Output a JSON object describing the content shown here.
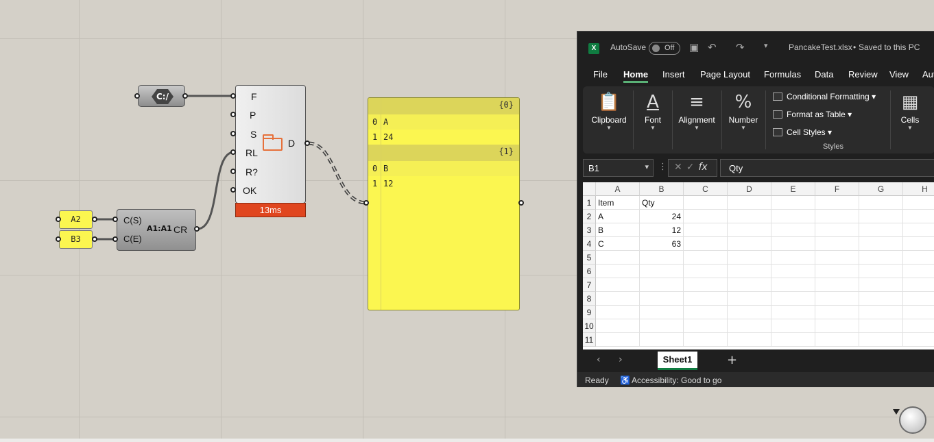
{
  "grasshopper": {
    "path_component": {
      "glyph": "C:/"
    },
    "panels_small": [
      {
        "text": "A2"
      },
      {
        "text": "B3"
      }
    ],
    "cell_range": {
      "inputs": [
        "C(S)",
        "C(E)"
      ],
      "output": "CR",
      "icon_text": "A1:A1"
    },
    "excel_reader": {
      "inputs": [
        "F",
        "P",
        "S",
        "RL",
        "R?",
        "OK"
      ],
      "output": "D",
      "time": "13ms"
    },
    "data_panel": {
      "branches": [
        {
          "path": "{0}",
          "items": [
            {
              "index": "0",
              "value": "A"
            },
            {
              "index": "1",
              "value": "24"
            }
          ]
        },
        {
          "path": "{1}",
          "items": [
            {
              "index": "0",
              "value": "B"
            },
            {
              "index": "1",
              "value": "12"
            }
          ]
        }
      ]
    }
  },
  "excel": {
    "title": {
      "autosave_label": "AutoSave",
      "autosave_state": "Off",
      "filename": "PancakeTest.xlsx",
      "save_status": "Saved to this PC"
    },
    "menu_tabs": [
      "File",
      "Home",
      "Insert",
      "Page Layout",
      "Formulas",
      "Data",
      "Review",
      "View",
      "Aut"
    ],
    "active_tab": "Home",
    "ribbon": {
      "clipboard": "Clipboard",
      "font": "Font",
      "alignment": "Alignment",
      "number": "Number",
      "conditional_formatting": "Conditional Formatting",
      "format_as_table": "Format as Table",
      "cell_styles": "Cell Styles",
      "styles_group": "Styles",
      "cells": "Cells"
    },
    "name_box": "B1",
    "fx_label": "fx",
    "formula": "Qty",
    "columns": [
      "A",
      "B",
      "C",
      "D",
      "E",
      "F",
      "G",
      "H"
    ],
    "rows": [
      {
        "n": "1",
        "A": "Item",
        "B": "Qty"
      },
      {
        "n": "2",
        "A": "A",
        "B": "24"
      },
      {
        "n": "3",
        "A": "B",
        "B": "12"
      },
      {
        "n": "4",
        "A": "C",
        "B": "63"
      },
      {
        "n": "5",
        "A": "",
        "B": ""
      },
      {
        "n": "6",
        "A": "",
        "B": ""
      },
      {
        "n": "7",
        "A": "",
        "B": ""
      },
      {
        "n": "8",
        "A": "",
        "B": ""
      },
      {
        "n": "9",
        "A": "",
        "B": ""
      },
      {
        "n": "10",
        "A": "",
        "B": ""
      },
      {
        "n": "11",
        "A": "",
        "B": ""
      }
    ],
    "sheet_tab": "Sheet1",
    "status": {
      "ready": "Ready",
      "accessibility": "Accessibility: Good to go"
    }
  }
}
